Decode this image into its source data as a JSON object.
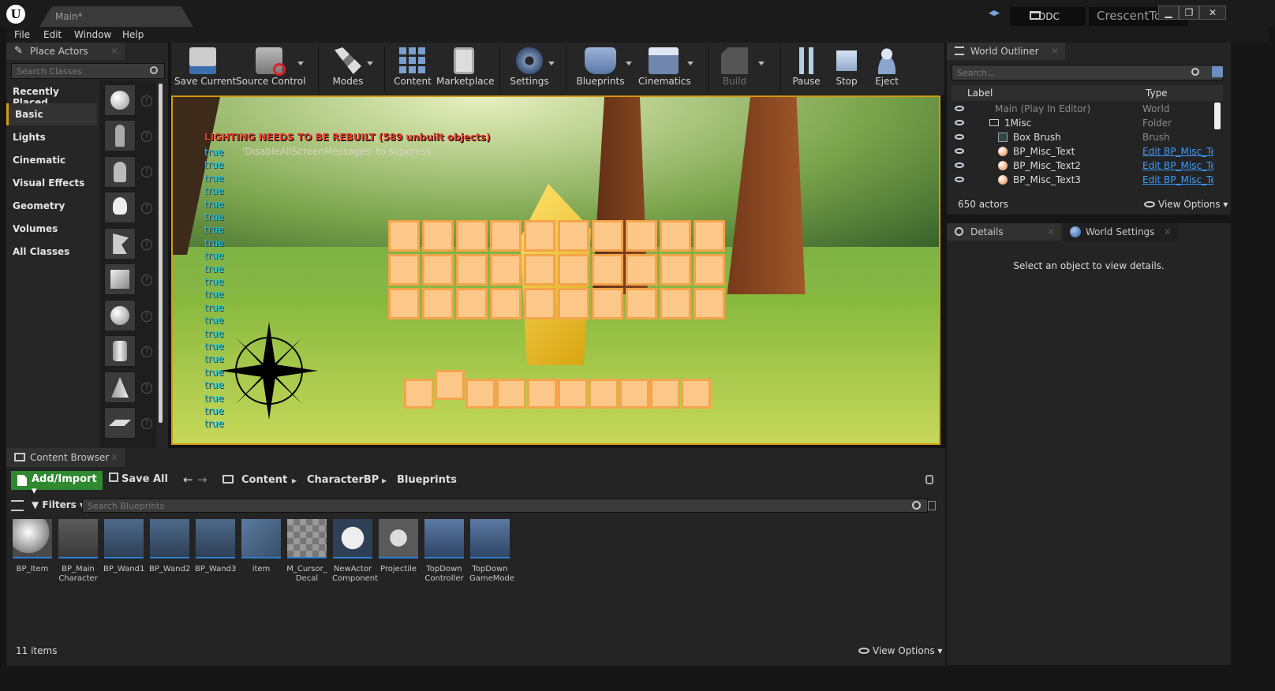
{
  "window": {
    "tab_title": "Main*",
    "ddc_label": "DDC",
    "project_name": "CrescentTown",
    "min": "▁",
    "restore": "❐",
    "close": "✕"
  },
  "menu": [
    "File",
    "Edit",
    "Window",
    "Help"
  ],
  "place_actors": {
    "title": "Place Actors",
    "search_placeholder": "Search Classes",
    "categories": [
      "Recently Placed",
      "Basic",
      "Lights",
      "Cinematic",
      "Visual Effects",
      "Geometry",
      "Volumes",
      "All Classes"
    ],
    "selected": "Basic"
  },
  "toolbar": {
    "save_current": "Save Current",
    "source_control": "Source Control",
    "modes": "Modes",
    "content": "Content",
    "marketplace": "Marketplace",
    "settings": "Settings",
    "blueprints": "Blueprints",
    "cinematics": "Cinematics",
    "build": "Build",
    "pause": "Pause",
    "stop": "Stop",
    "eject": "Eject"
  },
  "viewport": {
    "lighting_warning": "LIGHTING NEEDS TO BE REBUILT (589 unbuilt objects)",
    "suppress_msg": "'DisableAllScreenMessages' to suppress",
    "debug_lines": [
      "true",
      "true",
      "true",
      "true",
      "true",
      "true",
      "true",
      "true",
      "true",
      "true",
      "true",
      "true",
      "true",
      "true",
      "true",
      "true",
      "true",
      "true",
      "true",
      "true",
      "true",
      "true"
    ]
  },
  "outliner": {
    "title": "World Outliner",
    "search_placeholder": "Search...",
    "col_label": "Label",
    "col_type": "Type",
    "rows": [
      {
        "label": "Main (Play In Editor)",
        "type": "World"
      },
      {
        "label": "1Misc",
        "type": "Folder"
      },
      {
        "label": "Box Brush",
        "type": "Brush"
      },
      {
        "label": "BP_Misc_Text",
        "type": "Edit BP_Misc_Text"
      },
      {
        "label": "BP_Misc_Text2",
        "type": "Edit BP_Misc_Text"
      },
      {
        "label": "BP_Misc_Text3",
        "type": "Edit BP_Misc_Text"
      }
    ],
    "actor_count": "650 actors",
    "view_options": "View Options"
  },
  "details": {
    "tab_details": "Details",
    "tab_world_settings": "World Settings",
    "empty_msg": "Select an object to view details."
  },
  "content_browser": {
    "title": "Content Browser",
    "add_import": "Add/Import",
    "save_all": "Save All",
    "path": [
      "Content",
      "CharacterBP",
      "Blueprints"
    ],
    "filters": "Filters",
    "search_placeholder": "Search Blueprints",
    "assets": [
      {
        "name": "BP_Item"
      },
      {
        "name": "BP_Main Character"
      },
      {
        "name": "BP_Wand1"
      },
      {
        "name": "BP_Wand2"
      },
      {
        "name": "BP_Wand3"
      },
      {
        "name": "item"
      },
      {
        "name": "M_Cursor_ Decal"
      },
      {
        "name": "NewActor Component"
      },
      {
        "name": "Projectile"
      },
      {
        "name": "TopDown Controller"
      },
      {
        "name": "TopDown GameMode"
      }
    ],
    "item_count": "11 items",
    "view_options": "View Options"
  },
  "colors": {
    "accent_green": "#2f8a2f",
    "link_blue": "#3c9bff",
    "warning_red": "#e63a2a",
    "viewport_border": "#d49a14",
    "debug_cyan": "#12c8f0"
  }
}
